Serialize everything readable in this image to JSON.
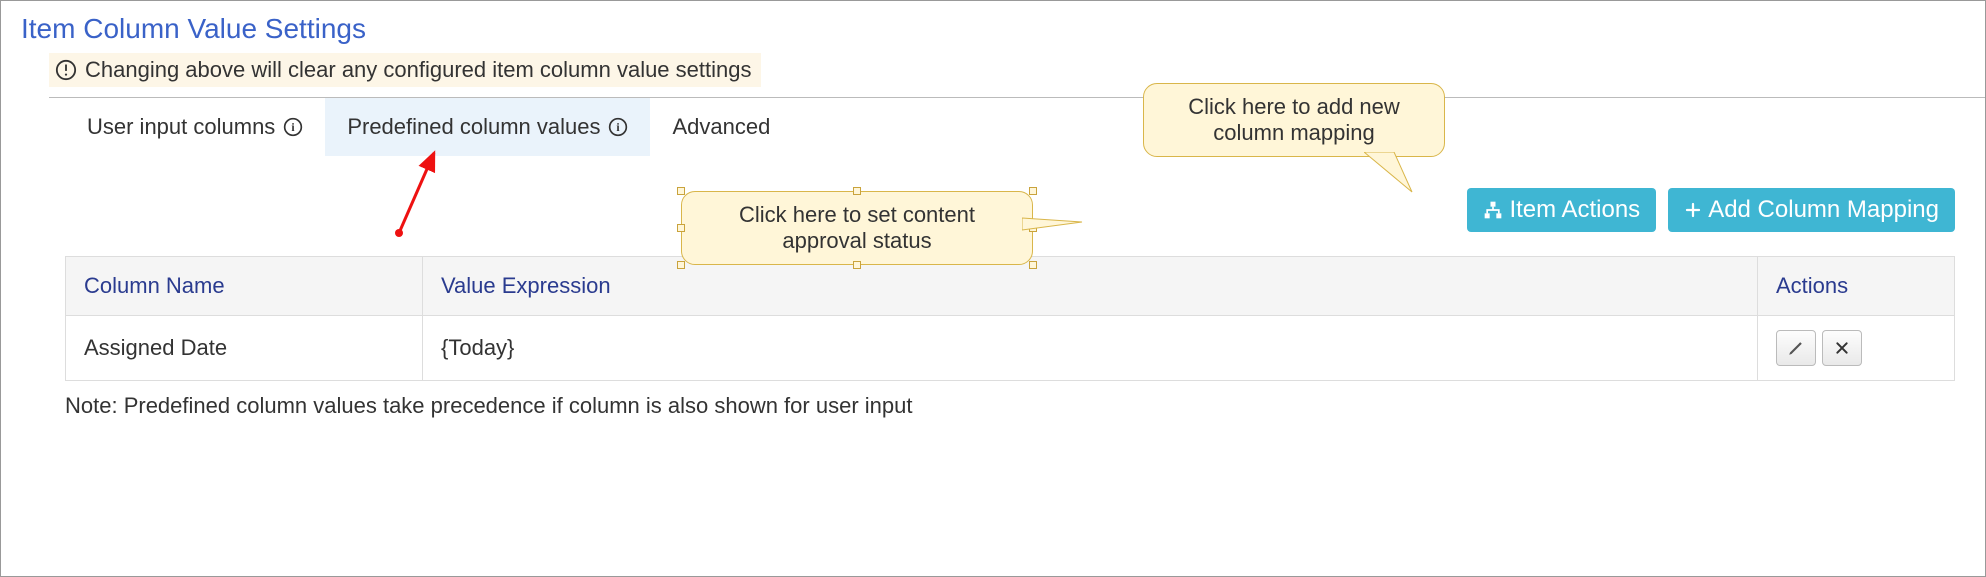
{
  "section": {
    "title": "Item Column Value Settings"
  },
  "warning": {
    "text": "Changing above will clear any configured item column value settings"
  },
  "tabs": {
    "user_input": "User input columns",
    "predefined": "Predefined column values",
    "advanced": "Advanced",
    "active_index": 1
  },
  "buttons": {
    "item_actions": "Item Actions",
    "add_mapping": "Add Column Mapping"
  },
  "table": {
    "headers": {
      "col_name": "Column Name",
      "val_expr": "Value Expression",
      "actions": "Actions"
    },
    "rows": [
      {
        "name": "Assigned Date",
        "expr": "{Today}"
      }
    ]
  },
  "footnote": "Note: Predefined column values take precedence if column is also shown for user input",
  "callouts": {
    "approval": "Click here to set content approval status",
    "add_new_line1": "Click here to add new",
    "add_new_line2": "column mapping"
  }
}
